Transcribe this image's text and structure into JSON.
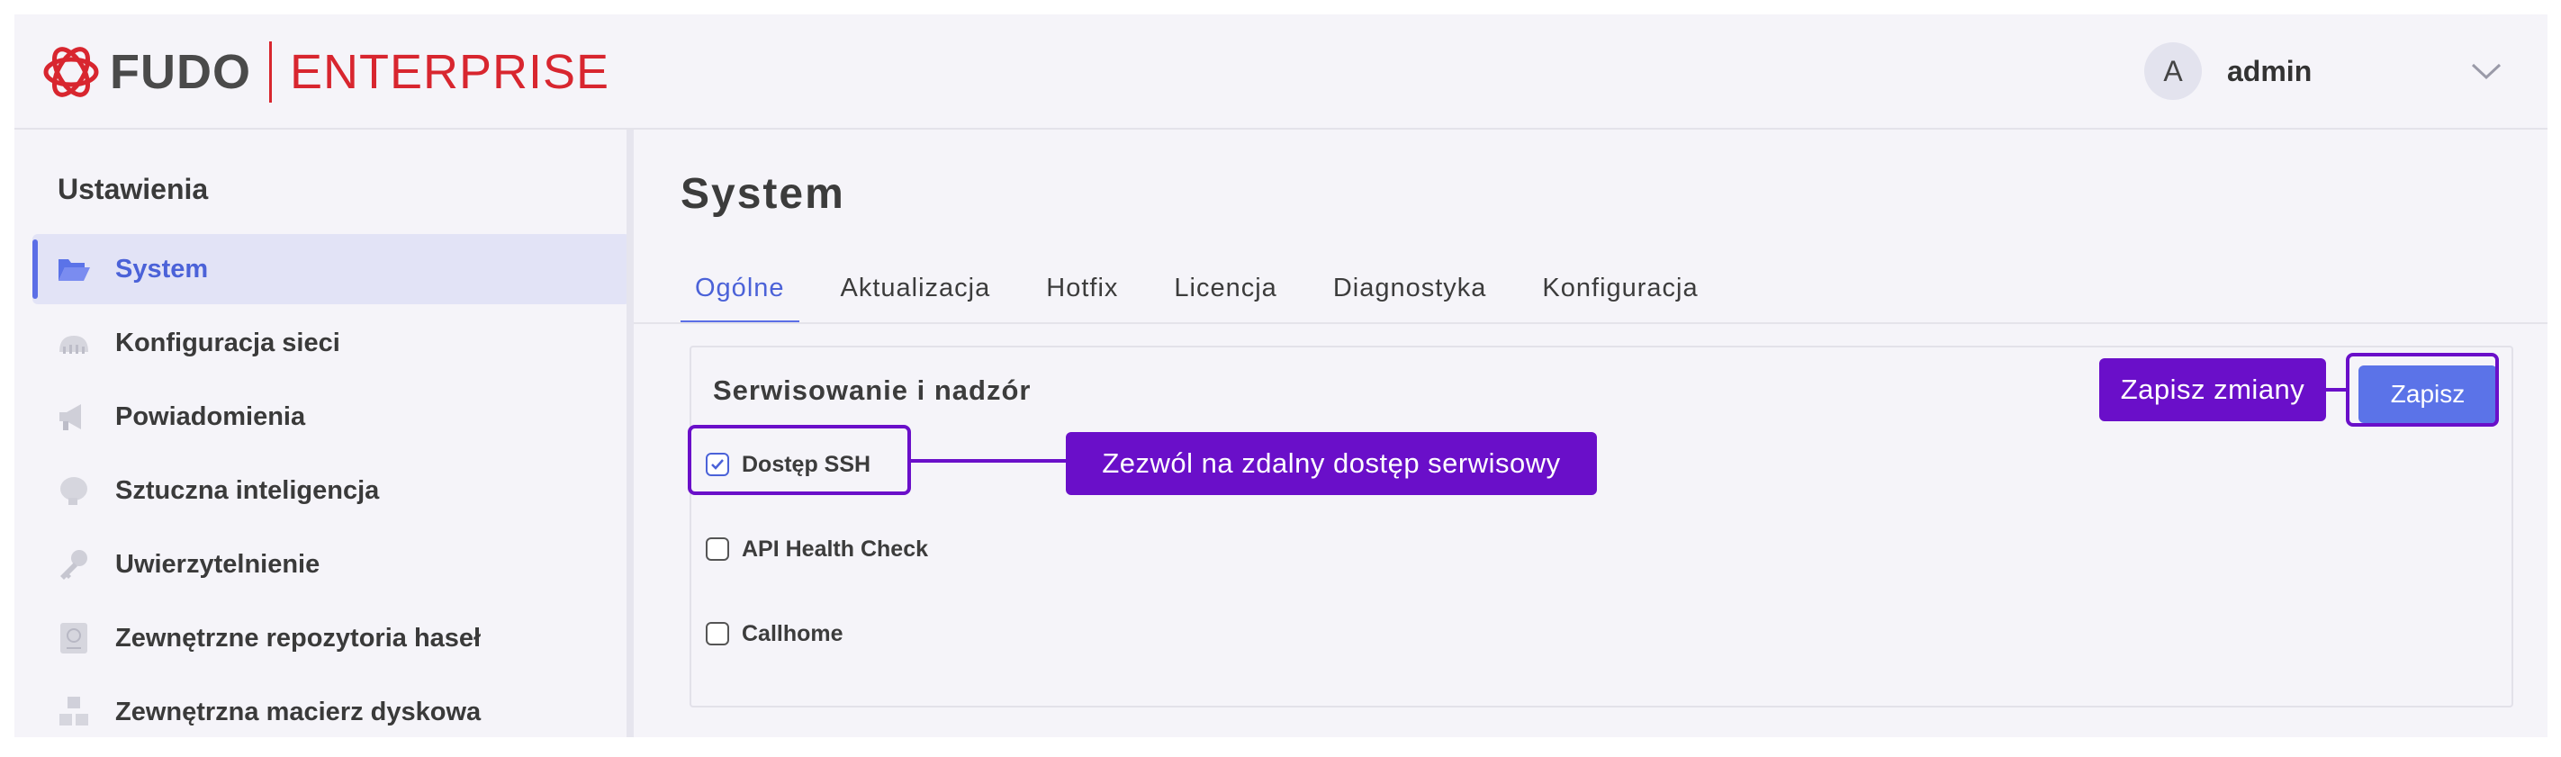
{
  "header": {
    "logo_primary": "FUDO",
    "logo_secondary": "ENTERPRISE",
    "avatar_letter": "A",
    "username": "admin"
  },
  "sidebar": {
    "title": "Ustawienia",
    "items": [
      {
        "label": "System",
        "icon": "folder-open-icon",
        "active": true
      },
      {
        "label": "Konfiguracja sieci",
        "icon": "network-icon",
        "active": false
      },
      {
        "label": "Powiadomienia",
        "icon": "megaphone-icon",
        "active": false
      },
      {
        "label": "Sztuczna inteligencja",
        "icon": "brain-icon",
        "active": false
      },
      {
        "label": "Uwierzytelnienie",
        "icon": "key-icon",
        "active": false
      },
      {
        "label": "Zewnętrzne repozytoria haseł",
        "icon": "vault-icon",
        "active": false
      },
      {
        "label": "Zewnętrzna macierz dyskowa",
        "icon": "boxes-icon",
        "active": false
      }
    ]
  },
  "main": {
    "title": "System",
    "tabs": [
      {
        "label": "Ogólne",
        "active": true
      },
      {
        "label": "Aktualizacja",
        "active": false
      },
      {
        "label": "Hotfix",
        "active": false
      },
      {
        "label": "Licencja",
        "active": false
      },
      {
        "label": "Diagnostyka",
        "active": false
      },
      {
        "label": "Konfiguracja",
        "active": false
      }
    ],
    "section": {
      "title": "Serwisowanie i nadzór",
      "save_label": "Zapisz",
      "options": [
        {
          "label": "Dostęp SSH",
          "checked": true
        },
        {
          "label": "API Health Check",
          "checked": false
        },
        {
          "label": "Callhome",
          "checked": false
        }
      ]
    }
  },
  "annotations": {
    "save_callout": "Zapisz zmiany",
    "ssh_callout": "Zezwól na zdalny dostęp serwisowy"
  },
  "colors": {
    "accent": "#5b73e8",
    "brand_red": "#d8262f",
    "annotation": "#6a0fc9"
  }
}
